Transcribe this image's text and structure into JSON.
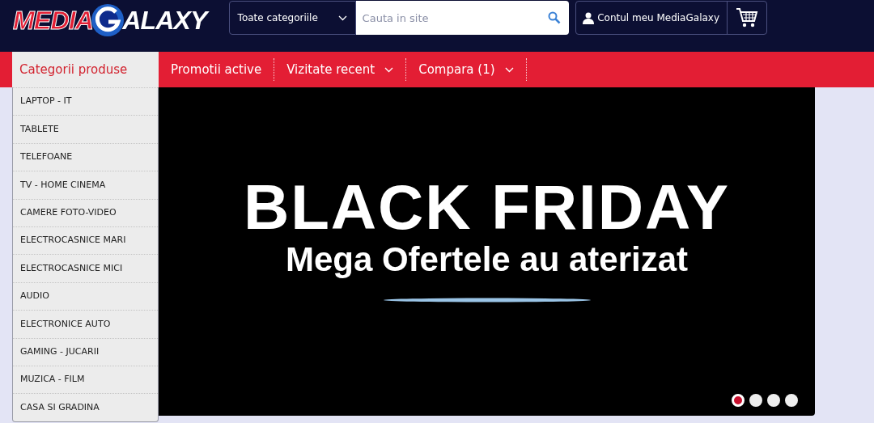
{
  "logo": {
    "part_1": "MEDIA",
    "part_2": "ALAXY"
  },
  "search": {
    "category": "Toate categoriile",
    "placeholder": "Cauta in site"
  },
  "account": {
    "label": "Contul meu MediaGalaxy"
  },
  "nav": {
    "categories_title": "Categorii produse",
    "items": [
      {
        "label": "Promotii active",
        "dropdown": false
      },
      {
        "label": "Vizitate recent",
        "dropdown": true
      },
      {
        "label": "Compara (1)",
        "dropdown": true
      }
    ]
  },
  "categories": [
    "LAPTOP - IT",
    "TABLETE",
    "TELEFOANE",
    "TV - HOME CINEMA",
    "CAMERE FOTO-VIDEO",
    "ELECTROCASNICE MARI",
    "ELECTROCASNICE MICI",
    "AUDIO",
    "ELECTRONICE AUTO",
    "GAMING - JUCARII",
    "MUZICA - FILM",
    "CASA SI GRADINA"
  ],
  "banner": {
    "title": "BLACK FRIDAY",
    "subtitle": "Mega Ofertele au aterizat"
  },
  "slides": [
    {
      "selected": true
    },
    {
      "selected": false
    },
    {
      "selected": false
    },
    {
      "selected": false
    }
  ]
}
